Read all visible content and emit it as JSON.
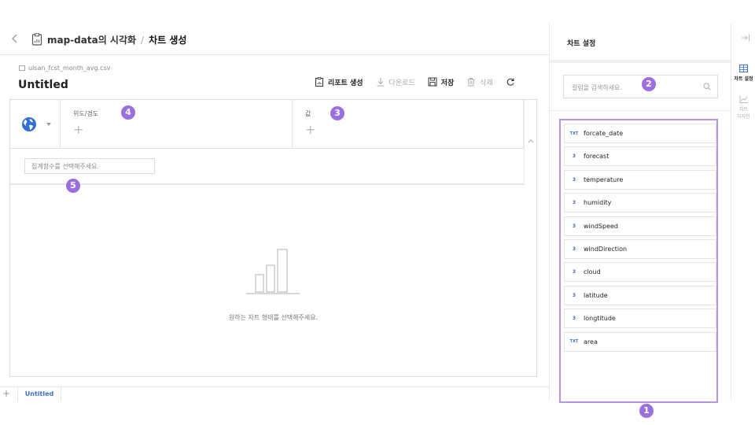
{
  "breadcrumb": {
    "parent": "map-data의 시각화",
    "separator": "/",
    "current": "차트 생성"
  },
  "dataset": {
    "file_name": "ulsan_fcst_month_avg.csv"
  },
  "report": {
    "title": "Untitled"
  },
  "toolbar": {
    "create_report": "리포트 생성",
    "download": "다운로드",
    "save": "저장",
    "delete": "삭제"
  },
  "builder": {
    "latlng_label": "위도/경도",
    "value_label": "값",
    "plus": "+",
    "aggregate_placeholder": "집계함수를 선택해주세요.",
    "empty_message": "원하는 차트 형태를 선택해주세요."
  },
  "tabs": {
    "add": "+",
    "active_tab": "Untitled"
  },
  "chart_settings": {
    "title": "차트 설정",
    "search_placeholder": "컬럼을 검색하세요.",
    "fields": [
      {
        "type": "TXT",
        "name": "forcate_date"
      },
      {
        "type": "3",
        "name": "forecast"
      },
      {
        "type": "3",
        "name": "temperature"
      },
      {
        "type": "3",
        "name": "humidity"
      },
      {
        "type": "3",
        "name": "windSpeed"
      },
      {
        "type": "3",
        "name": "windDirection"
      },
      {
        "type": "3",
        "name": "cloud"
      },
      {
        "type": "3",
        "name": "latitude"
      },
      {
        "type": "3",
        "name": "longtitude"
      },
      {
        "type": "TXT",
        "name": "area"
      }
    ]
  },
  "side_rail": {
    "chart_settings_label": "차트 설정",
    "chart_design_label_1": "차트",
    "chart_design_label_2": "디자인"
  },
  "annotations": {
    "b1": "1",
    "b2": "2",
    "b3": "3",
    "b4": "4",
    "b5": "5"
  },
  "colors": {
    "accent": "#3b6fd1",
    "annotation": "#9b6fe0",
    "highlight_border": "#b394e8"
  }
}
